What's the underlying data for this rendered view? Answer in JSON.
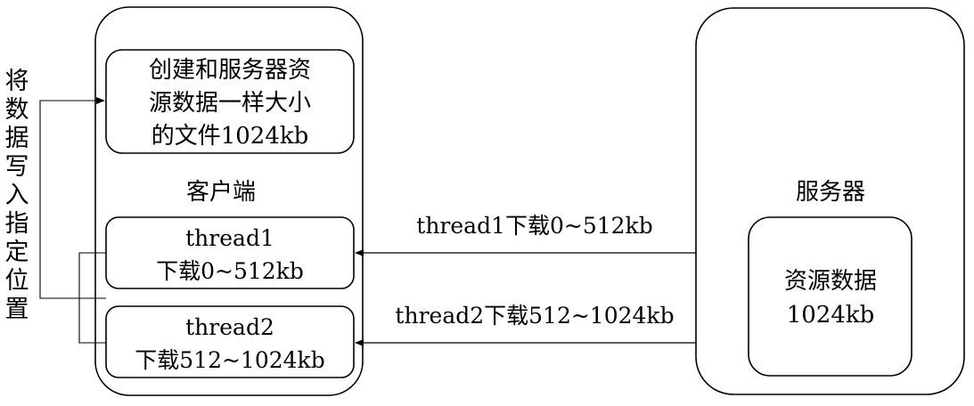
{
  "side_label": [
    "将",
    "数",
    "据",
    "写",
    "入",
    "指",
    "定",
    "位",
    "置"
  ],
  "client": {
    "label": "客户端",
    "file_box": {
      "lines": [
        "创建和服务器资",
        "源数据一样大小",
        "的文件1024kb"
      ]
    },
    "thread1_box": {
      "lines": [
        "thread1",
        "下载0~512kb"
      ]
    },
    "thread2_box": {
      "lines": [
        "thread2",
        "下载512~1024kb"
      ]
    }
  },
  "server": {
    "label": "服务器",
    "resource_box": {
      "lines": [
        "资源数据",
        "1024kb"
      ]
    }
  },
  "arrows": {
    "thread1_label": "thread1下载0~512kb",
    "thread2_label": "thread2下载512~1024kb"
  },
  "colors": {
    "stroke": "#000000",
    "background": "#ffffff"
  }
}
